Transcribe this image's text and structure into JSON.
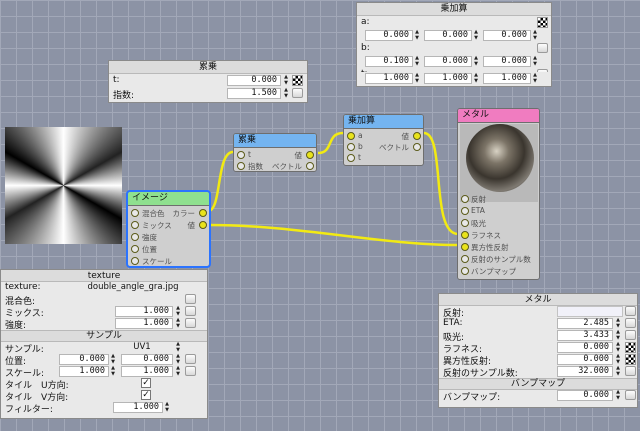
{
  "panel_multiply": {
    "title": "累乗",
    "rows": [
      {
        "label": "t:",
        "value": "0.000"
      },
      {
        "label": "指数:",
        "value": "1.500"
      }
    ]
  },
  "panel_muladd": {
    "title": "乗加算",
    "rows": [
      {
        "label": "a:",
        "values": [
          "0.000",
          "0.000",
          "0.000"
        ]
      },
      {
        "label": "b:",
        "values": [
          "0.100",
          "0.000",
          "0.000"
        ]
      },
      {
        "label": "t:",
        "values": [
          "1.000",
          "1.000",
          "1.000"
        ]
      }
    ]
  },
  "panel_texture": {
    "title": "texture",
    "texture_label": "texture:",
    "texture_file": "double_angle_gra.jpg",
    "blend_label": "混合色:",
    "mix_label": "ミックス:",
    "mix_value": "1.000",
    "strength_label": "強度:",
    "strength_value": "1.000",
    "sampler_section": "サンプル",
    "sampler_label": "サンプル:",
    "sampler_value": "UV1",
    "position_label": "位置:",
    "position_values": [
      "0.000",
      "0.000"
    ],
    "scale_label": "スケール:",
    "scale_values": [
      "1.000",
      "1.000"
    ],
    "tile_u_label": "タイル　U方向:",
    "tile_v_label": "タイル　V方向:",
    "filter_label": "フィルター:",
    "filter_value": "1.000"
  },
  "panel_metal": {
    "title": "メタル",
    "reflection_label": "反射:",
    "eta_label": "ETA:",
    "eta_value": "2.485",
    "absorb_label": "吸光:",
    "absorb_value": "3.433",
    "roughness_label": "ラフネス:",
    "roughness_value": "0.000",
    "aniso_label": "異方性反射:",
    "aniso_value": "0.000",
    "samples_label": "反射のサンプル数:",
    "samples_value": "32.000",
    "bump_section": "バンプマップ",
    "bump_label": "バンプマップ:",
    "bump_value": "0.000"
  },
  "node_image": {
    "title": "イメージ",
    "inputs": [
      "混合色",
      "ミックス",
      "強度",
      "位置",
      "スケール"
    ],
    "outputs": [
      "カラー",
      "値"
    ]
  },
  "node_power": {
    "title": "累乗",
    "inputs": [
      "t",
      "指数"
    ],
    "outputs": [
      "値",
      "ベクトル"
    ]
  },
  "node_muladd": {
    "title": "乗加算",
    "inputs": [
      "a",
      "b",
      "t"
    ],
    "outputs": [
      "値",
      "ベクトル"
    ]
  },
  "node_metal": {
    "title": "メタル",
    "inputs": [
      "反射",
      "ETA",
      "吸光",
      "ラフネス",
      "異方性反射",
      "反射のサンプル数",
      "バンプマップ"
    ]
  },
  "colors": {
    "wire": "#f2ea12",
    "image_header": "#8fe08f",
    "power_header": "#74b4f0",
    "metal_header": "#f07cc0",
    "selection": "#2b73ff"
  }
}
